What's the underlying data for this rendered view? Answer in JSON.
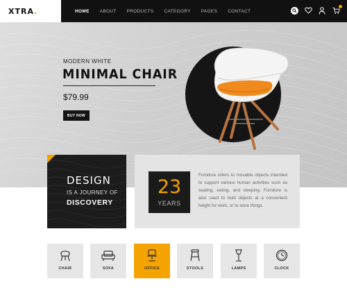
{
  "brand": {
    "name": "XTRA",
    "dot": "."
  },
  "nav": {
    "items": [
      {
        "label": "HOME",
        "active": true
      },
      {
        "label": "ABOUT",
        "active": false
      },
      {
        "label": "PRODUCTS",
        "active": false
      },
      {
        "label": "CATEGORY",
        "active": false
      },
      {
        "label": "PAGES",
        "active": false
      },
      {
        "label": "CONTACT",
        "active": false
      }
    ],
    "icons": [
      "search-icon",
      "heart-icon",
      "user-icon",
      "cart-icon"
    ]
  },
  "hero": {
    "subtitle": "MODERN WHITE",
    "title": "MINIMAL CHAIR",
    "price": "$79.99",
    "button": "BUY NOW"
  },
  "design_card": {
    "title": "DESIGN",
    "subtitle": "IS A JOURNEY OF",
    "bottom": "DISCOVERY"
  },
  "info": {
    "years_number": "23",
    "years_label": "YEARS",
    "text": "Furniture refers to movable objects intended to support various human activities such as seating, eating, and sleeping. Furniture is also used to hold objects at a convenient height for work, or to store things."
  },
  "categories": [
    {
      "label": "CHAIR",
      "icon": "chair-icon",
      "active": false
    },
    {
      "label": "SOFA",
      "icon": "sofa-icon",
      "active": false
    },
    {
      "label": "OFFICE",
      "icon": "office-chair-icon",
      "active": true
    },
    {
      "label": "STOOLS",
      "icon": "stool-icon",
      "active": false
    },
    {
      "label": "LAMPS",
      "icon": "lamp-icon",
      "active": false
    },
    {
      "label": "CLOCK",
      "icon": "clock-icon",
      "active": false
    }
  ],
  "colors": {
    "accent": "#f5a300",
    "dark": "#111111",
    "hero_bg": "#d2d2d2",
    "panel_bg": "#e4e4e4"
  }
}
